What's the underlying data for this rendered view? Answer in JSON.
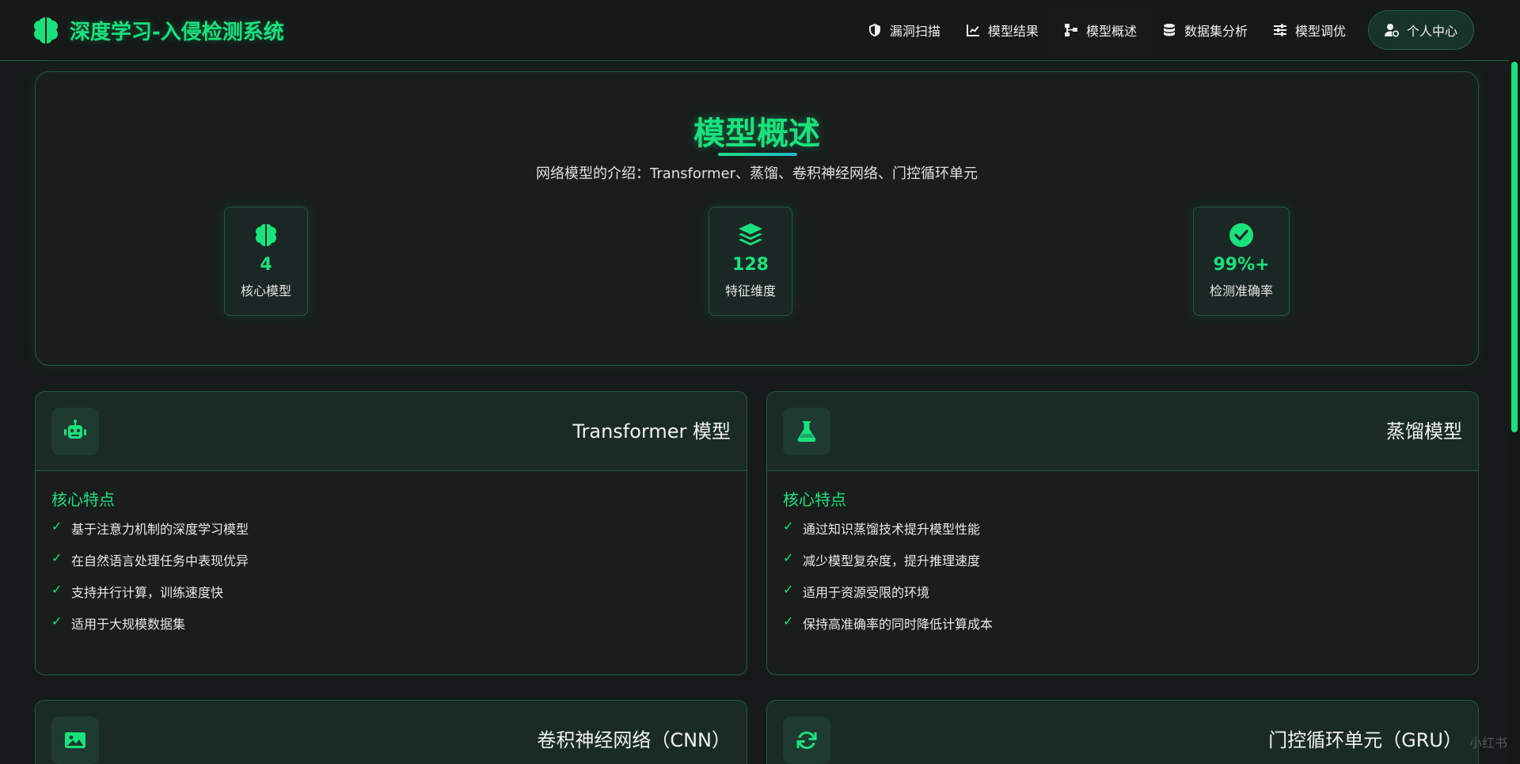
{
  "brand": {
    "title": "深度学习-入侵检测系统",
    "icon": "brain-icon"
  },
  "nav": [
    {
      "label": "漏洞扫描",
      "icon": "shield-icon"
    },
    {
      "label": "模型结果",
      "icon": "line-chart-icon"
    },
    {
      "label": "模型概述",
      "icon": "sitemap-icon",
      "active": true
    },
    {
      "label": "数据集分析",
      "icon": "database-icon"
    },
    {
      "label": "模型调优",
      "icon": "sliders-icon"
    }
  ],
  "user": {
    "label": "个人中心",
    "icon": "user-cog-icon"
  },
  "hero": {
    "title": "模型概述",
    "subtitle": "网络模型的介绍：Transformer、蒸馏、卷积神经网络、门控循环单元"
  },
  "stats": [
    {
      "value": "4",
      "label": "核心模型",
      "icon": "brain-icon"
    },
    {
      "value": "128",
      "label": "特征维度",
      "icon": "layers-icon"
    },
    {
      "value": "99%+",
      "label": "检测准确率",
      "icon": "check-circle-icon"
    }
  ],
  "cards": [
    {
      "title": "Transformer 模型",
      "icon": "robot-icon",
      "section": "核心特点",
      "features": [
        "基于注意力机制的深度学习模型",
        "在自然语言处理任务中表现优异",
        "支持并行计算，训练速度快",
        "适用于大规模数据集"
      ]
    },
    {
      "title": "蒸馏模型",
      "icon": "flask-icon",
      "section": "核心特点",
      "features": [
        "通过知识蒸馏技术提升模型性能",
        "减少模型复杂度，提升推理速度",
        "适用于资源受限的环境",
        "保持高准确率的同时降低计算成本"
      ]
    },
    {
      "title": "卷积神经网络（CNN）",
      "icon": "image-icon"
    },
    {
      "title": "门控循环单元（GRU）",
      "icon": "sync-icon"
    }
  ],
  "watermark": "小红书",
  "colors": {
    "accent": "#19e27d",
    "background": "#161a1a",
    "border": "#1e5b40"
  }
}
